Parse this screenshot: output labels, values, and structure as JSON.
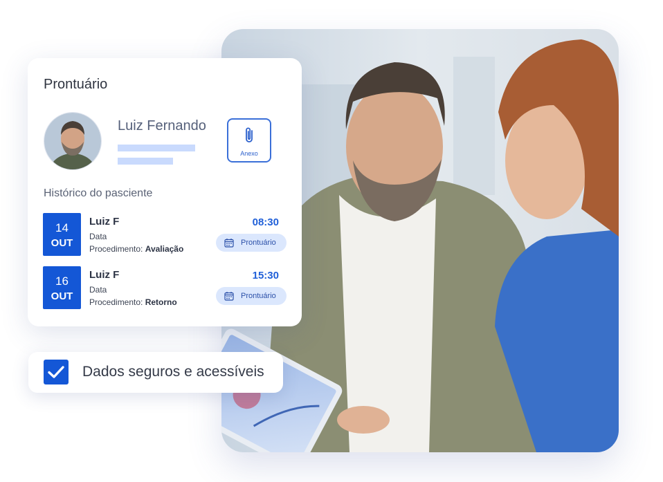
{
  "record_card": {
    "title": "Prontuário",
    "patient_name": "Luiz Fernando",
    "attachment_label": "Anexo",
    "history_title": "Histórico do pasciente"
  },
  "appointments": [
    {
      "day": "14",
      "month": "OUT",
      "name": "Luiz F",
      "data_label": "Data",
      "procedure_label": "Procedimento:",
      "procedure_value": "Avaliação",
      "time": "08:30",
      "button_label": "Prontuário"
    },
    {
      "day": "16",
      "month": "OUT",
      "name": "Luiz F",
      "data_label": "Data",
      "procedure_label": "Procedimento:",
      "procedure_value": "Retorno",
      "time": "15:30",
      "button_label": "Prontuário"
    }
  ],
  "badge": {
    "text": "Dados seguros e acessíveis",
    "checked": true
  },
  "icons": {
    "attachment": "paperclip-icon",
    "calendar": "calendar-icon",
    "check": "check-icon"
  },
  "colors": {
    "accent": "#1457d6",
    "accent_text": "#1f5fd8",
    "pill_bg": "#dbe7fd",
    "skeleton": "#c9dafd"
  }
}
